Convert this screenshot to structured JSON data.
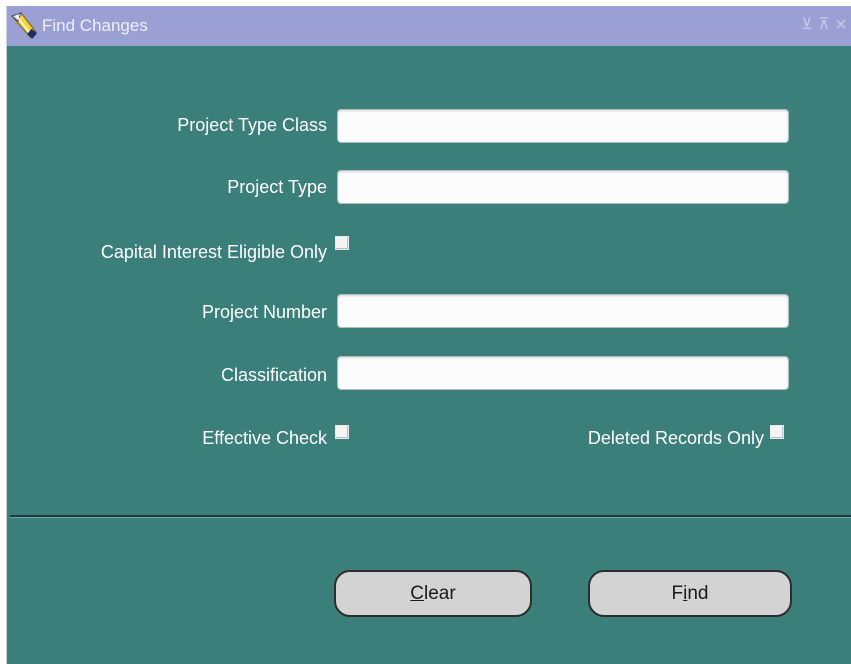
{
  "window": {
    "title": "Find Changes",
    "controls": {
      "minimize": "⊻",
      "restore": "⊼",
      "close": "×"
    }
  },
  "form": {
    "project_type_class": {
      "label": "Project Type Class",
      "value": ""
    },
    "project_type": {
      "label": "Project Type",
      "value": ""
    },
    "capital_interest": {
      "label": "Capital Interest Eligible Only",
      "checked": false
    },
    "project_number": {
      "label": "Project Number",
      "value": ""
    },
    "classification": {
      "label": "Classification",
      "value": ""
    },
    "effective_check": {
      "label": "Effective Check",
      "checked": false
    },
    "deleted_records": {
      "label": "Deleted Records Only",
      "checked": false
    }
  },
  "buttons": {
    "clear": {
      "mnemonic": "C",
      "rest": "lear"
    },
    "find": {
      "pre": "F",
      "mnemonic": "i",
      "rest": "nd"
    }
  },
  "colors": {
    "window_bg": "#3b7f7b",
    "titlebar_bg": "#9a9fd4",
    "button_bg": "#d3d3d3"
  }
}
